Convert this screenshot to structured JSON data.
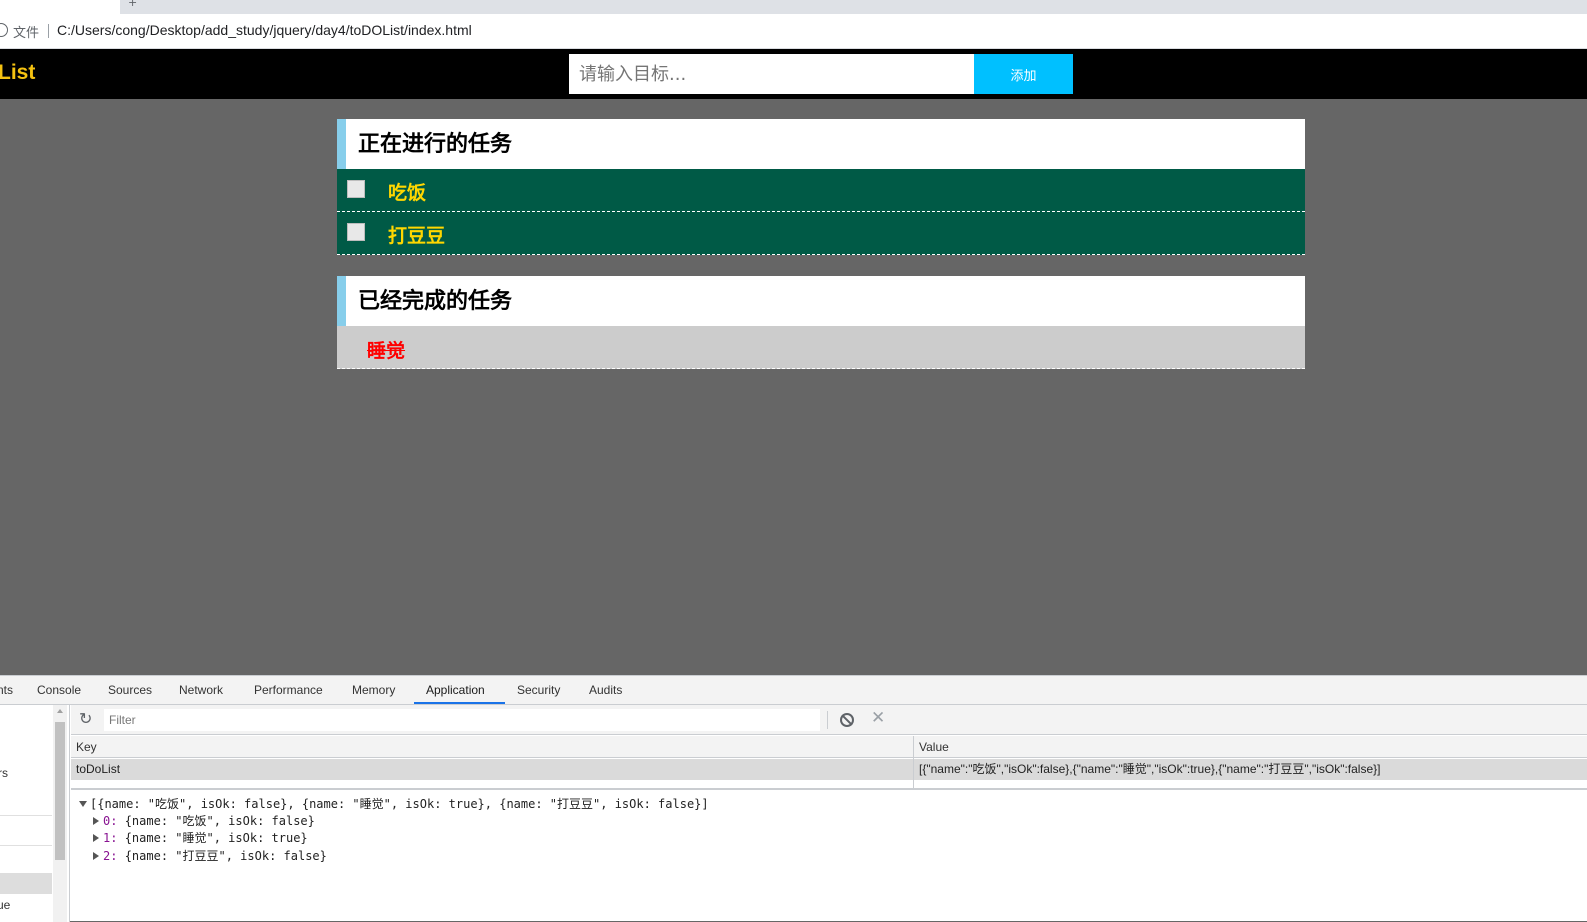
{
  "browser": {
    "scheme_label": "文件",
    "url": "C:/Users/cong/Desktop/add_study/jquery/day4/toDOList/index.html"
  },
  "page": {
    "logo": "List",
    "input_placeholder": "请输入目标...",
    "add_button": "添加",
    "doing": {
      "title": "正在进行的任务",
      "items": [
        "吃饭",
        "打豆豆"
      ]
    },
    "done": {
      "title": "已经完成的任务",
      "items": [
        "睡觉"
      ]
    }
  },
  "devtools": {
    "tabs": [
      "nts",
      "Console",
      "Sources",
      "Network",
      "Performance",
      "Memory",
      "Application",
      "Security",
      "Audits"
    ],
    "active_tab": "Application",
    "sidebar_fragments": [
      "rs",
      "ue"
    ],
    "filter_placeholder": "Filter",
    "table": {
      "headers": [
        "Key",
        "Value"
      ],
      "rows": [
        {
          "key": "toDoList",
          "value": "[{\"name\":\"吃饭\",\"isOk\":false},{\"name\":\"睡觉\",\"isOk\":true},{\"name\":\"打豆豆\",\"isOk\":false}]"
        }
      ]
    },
    "preview": {
      "root": "[{name: \"吃饭\", isOk: false}, {name: \"睡觉\", isOk: true}, {name: \"打豆豆\", isOk: false}]",
      "children": [
        {
          "index": "0",
          "value": "{name: \"吃饭\", isOk: false}"
        },
        {
          "index": "1",
          "value": "{name: \"睡觉\", isOk: true}"
        },
        {
          "index": "2",
          "value": "{name: \"打豆豆\", isOk: false}"
        }
      ]
    }
  },
  "colors": {
    "page_bg": "#666666",
    "header_bg": "#000000",
    "logo": "#f5c211",
    "add_button": "#00c0ff",
    "section_accent": "#87ceeb",
    "doing_row": "#005a46",
    "doing_text": "#ffd700",
    "done_row": "#cccccc",
    "done_text": "#ff0000"
  }
}
